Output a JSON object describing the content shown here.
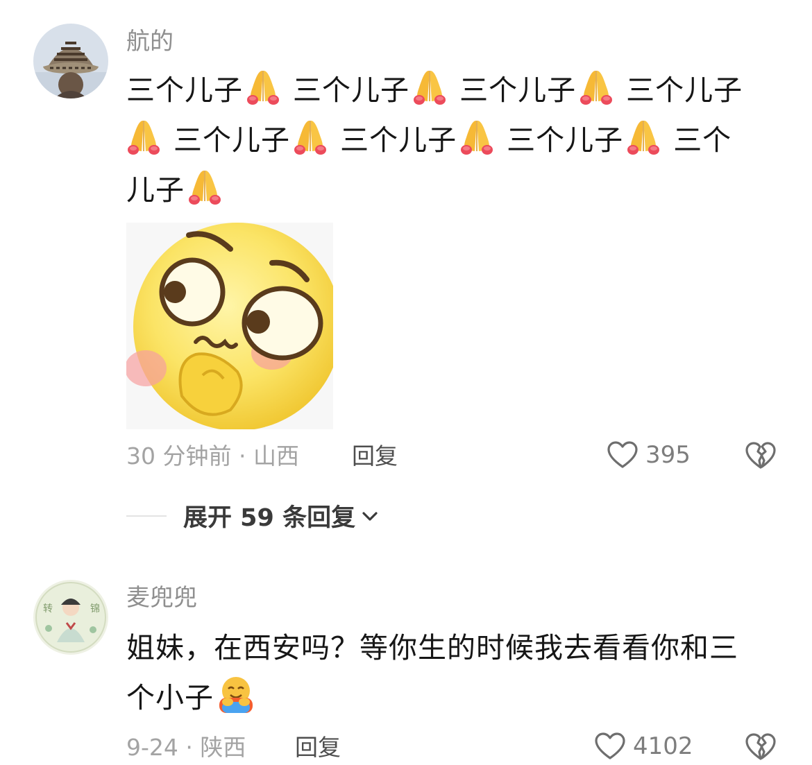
{
  "comments": [
    {
      "username": "航的",
      "text_line1": "三个儿子",
      "text_line2": "三个儿子",
      "text_line3": "三个儿子",
      "text_line4": "三个儿子",
      "text_line5": "三个儿子",
      "text_line6": "三个儿子",
      "text_line7": "三个儿子",
      "text_line8a": "三个",
      "text_line8b": "儿子",
      "inline_emoji": "folded-hands",
      "sticker": "shy-yellow-face",
      "time": "30 分钟前 · 山西",
      "reply_label": "回复",
      "likes": "395",
      "expand_label": "展开 59 条回复"
    },
    {
      "username": "麦兜兜",
      "text": "姐妹，在西安吗？等你生的时候我去看看你和三个小子",
      "text_part1": "姐妹，在西安吗？等你生的时候我去看看你和三",
      "text_part2": "个小子",
      "inline_emoji": "hugging-face",
      "time": "9-24 · 陕西",
      "reply_label": "回复",
      "likes": "4102"
    }
  ],
  "colors": {
    "username": "#8f8f8f",
    "text": "#161616",
    "meta": "#a3a3a3",
    "reply": "#4e4e4e",
    "likes": "#7d7d7d"
  }
}
